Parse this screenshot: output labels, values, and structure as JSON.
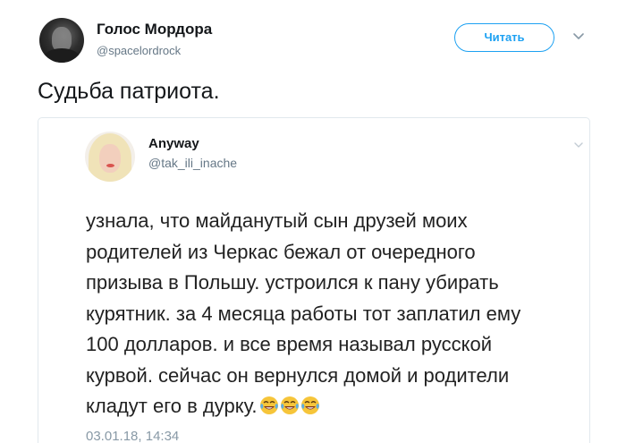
{
  "author": {
    "name": "Голос Мордора",
    "handle": "@spacelordrock",
    "avatar_icon": "profile-avatar"
  },
  "follow_button": {
    "label": "Читать",
    "color": "#1da1f2"
  },
  "menu_icon": "chevron-down-icon",
  "tweet": {
    "text": "Судьба патриота."
  },
  "quoted": {
    "name": "Anyway",
    "handle": "@tak_ili_inache",
    "lines": [
      "узнала, что майданутый сын друзей моих",
      "родителей из Черкас бежал от очередного",
      "призыва в Польшу. устроился к пану убирать",
      "курятник. за 4 месяца работы тот заплатил ему",
      "100 долларов. и все время называл русской",
      "курвой. сейчас он вернулся домой и родители",
      "кладут его в дурку."
    ],
    "emoji": [
      "face-with-tears-of-joy",
      "face-with-tears-of-joy",
      "face-with-tears-of-joy"
    ],
    "date": "03.01.18, 14:34"
  },
  "colors": {
    "text": "#14171a",
    "secondary": "#657786",
    "border": "#e1e8ed",
    "accent": "#1da1f2"
  }
}
